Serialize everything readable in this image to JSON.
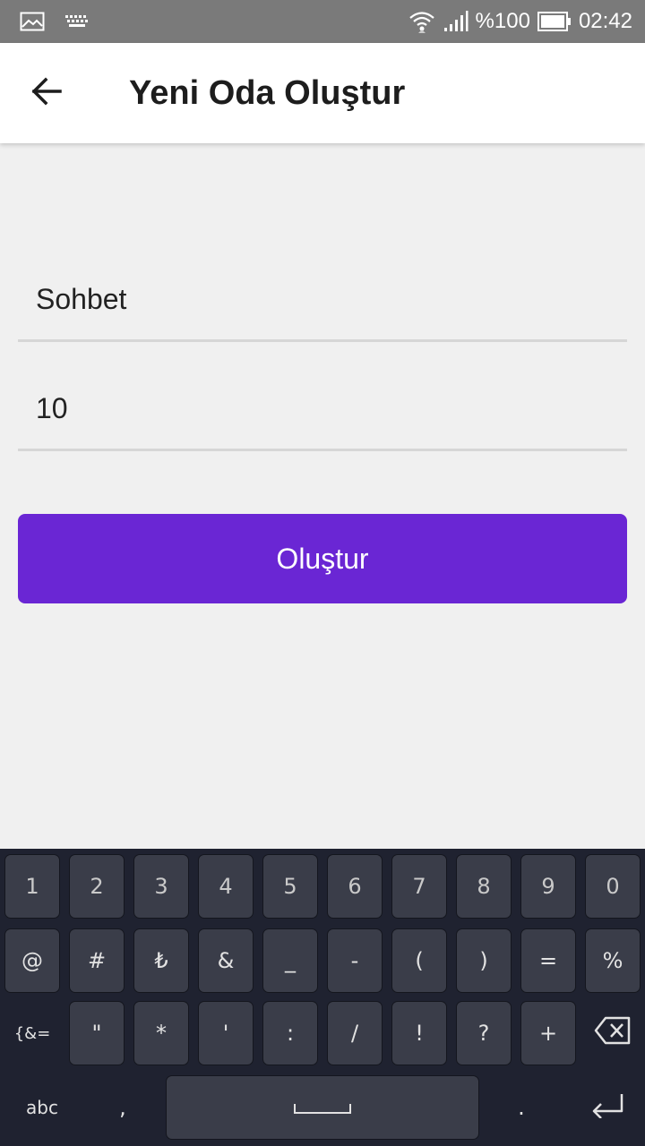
{
  "status_bar": {
    "battery_text": "%100",
    "time": "02:42",
    "icons": [
      "gallery-icon",
      "keyboard-notification-icon",
      "wifi-icon",
      "signal-icon",
      "battery-icon"
    ]
  },
  "app_bar": {
    "title": "Yeni Oda Oluştur",
    "back_icon": "arrow-left-icon"
  },
  "form": {
    "room_name_value": "Sohbet",
    "capacity_value": "10",
    "submit_label": "Oluştur"
  },
  "colors": {
    "accent": "#6a26d4",
    "status_bar": "#7a7a7a",
    "keyboard_bg": "#1f2230",
    "key_bg": "#3a3d49"
  },
  "keyboard": {
    "row1": [
      "1",
      "2",
      "3",
      "4",
      "5",
      "6",
      "7",
      "8",
      "9",
      "0"
    ],
    "row2": [
      "@",
      "#",
      "₺",
      "&",
      "_",
      "-",
      "(",
      ")",
      "=",
      "%"
    ],
    "row3_mode": "{&=",
    "row3": [
      "\"",
      "*",
      "'",
      ":",
      "/",
      "!",
      "?",
      "+"
    ],
    "row4_mode": "abc",
    "row4_comma": ",",
    "row4_period": ".",
    "backspace_icon": "backspace-icon",
    "space_icon": "space-icon",
    "enter_icon": "enter-icon"
  }
}
